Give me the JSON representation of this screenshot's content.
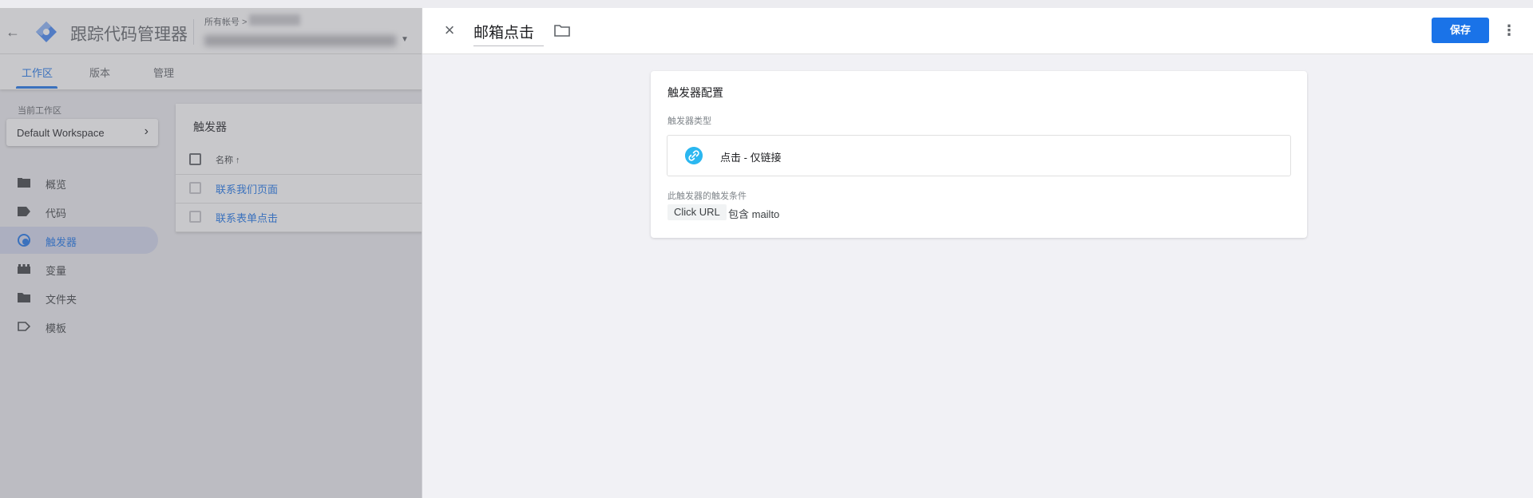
{
  "app": {
    "title": "跟踪代码管理器",
    "account_label": "所有帐号 >"
  },
  "tabs": [
    {
      "label": "工作区",
      "active": true
    },
    {
      "label": "版本",
      "active": false
    },
    {
      "label": "管理",
      "active": false
    }
  ],
  "workspace": {
    "label": "当前工作区",
    "name": "Default Workspace"
  },
  "nav": [
    {
      "label": "概览",
      "icon": "overview-icon",
      "active": false
    },
    {
      "label": "代码",
      "icon": "tag-icon",
      "active": false
    },
    {
      "label": "触发器",
      "icon": "trigger-icon",
      "active": true
    },
    {
      "label": "变量",
      "icon": "variable-icon",
      "active": false
    },
    {
      "label": "文件夹",
      "icon": "folder-icon",
      "active": false
    },
    {
      "label": "模板",
      "icon": "template-icon",
      "active": false
    }
  ],
  "triggers_panel": {
    "title": "触发器",
    "column_name": "名称 ↑",
    "rows": [
      "联系我们页面",
      "联系表单点击"
    ]
  },
  "sheet": {
    "trigger_name": "邮箱点击",
    "save_label": "保存",
    "card_title": "触发器配置",
    "type_label": "触发器类型",
    "type_name": "点击 - 仅链接",
    "condition_label": "此触发器的触发条件",
    "condition_variable": "Click URL",
    "condition_operator_value": "包含 mailto"
  },
  "colors": {
    "accent": "#1a73e8",
    "link_icon": "#2bb7f0"
  }
}
